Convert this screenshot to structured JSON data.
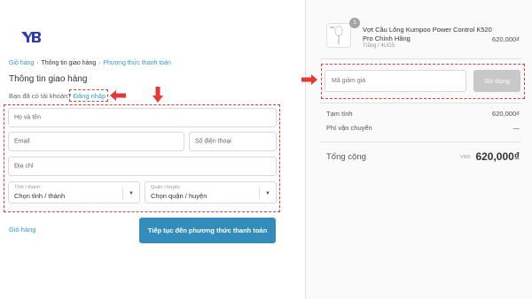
{
  "checkout": {
    "breadcrumb": [
      {
        "label": "Giỏ hàng"
      },
      {
        "label": "Thông tin giao hàng"
      },
      {
        "label": "Phương thức thanh toán"
      }
    ],
    "section_title": "Thông tin giao hàng",
    "login_prompt": "Bạn đã có tài khoản?",
    "login_link": "Đăng nhập",
    "fields": {
      "name_placeholder": "Họ và tên",
      "email_placeholder": "Email",
      "phone_placeholder": "Số điện thoại",
      "address_placeholder": "Địa chỉ",
      "province_label": "Tỉnh / thành",
      "province_value": "Chọn tỉnh / thành",
      "district_label": "Quận / huyện",
      "district_value": "Chọn quận / huyện"
    },
    "back_link": "Giỏ hàng",
    "continue_button": "Tiếp tục đến phương thức thanh toán"
  },
  "order": {
    "product": {
      "quantity": "1",
      "name": "Vợt Cầu Lông Kumpoo Power Control K520 Pro Chính Hãng",
      "variant": "Trắng / 4UG5",
      "price": "620,000₫"
    },
    "coupon_placeholder": "Mã giảm giá",
    "coupon_button": "Sử dụng",
    "subtotal_label": "Tạm tính",
    "subtotal_value": "620,000₫",
    "shipping_label": "Phí vận chuyển",
    "shipping_value": "—",
    "total_label": "Tổng cộng",
    "total_currency": "VND",
    "total_value": "620,000₫"
  },
  "colors": {
    "accent": "#338dbc",
    "link": "#2a9dcc",
    "highlight": "#e53935",
    "logo": "#2a3db5"
  }
}
